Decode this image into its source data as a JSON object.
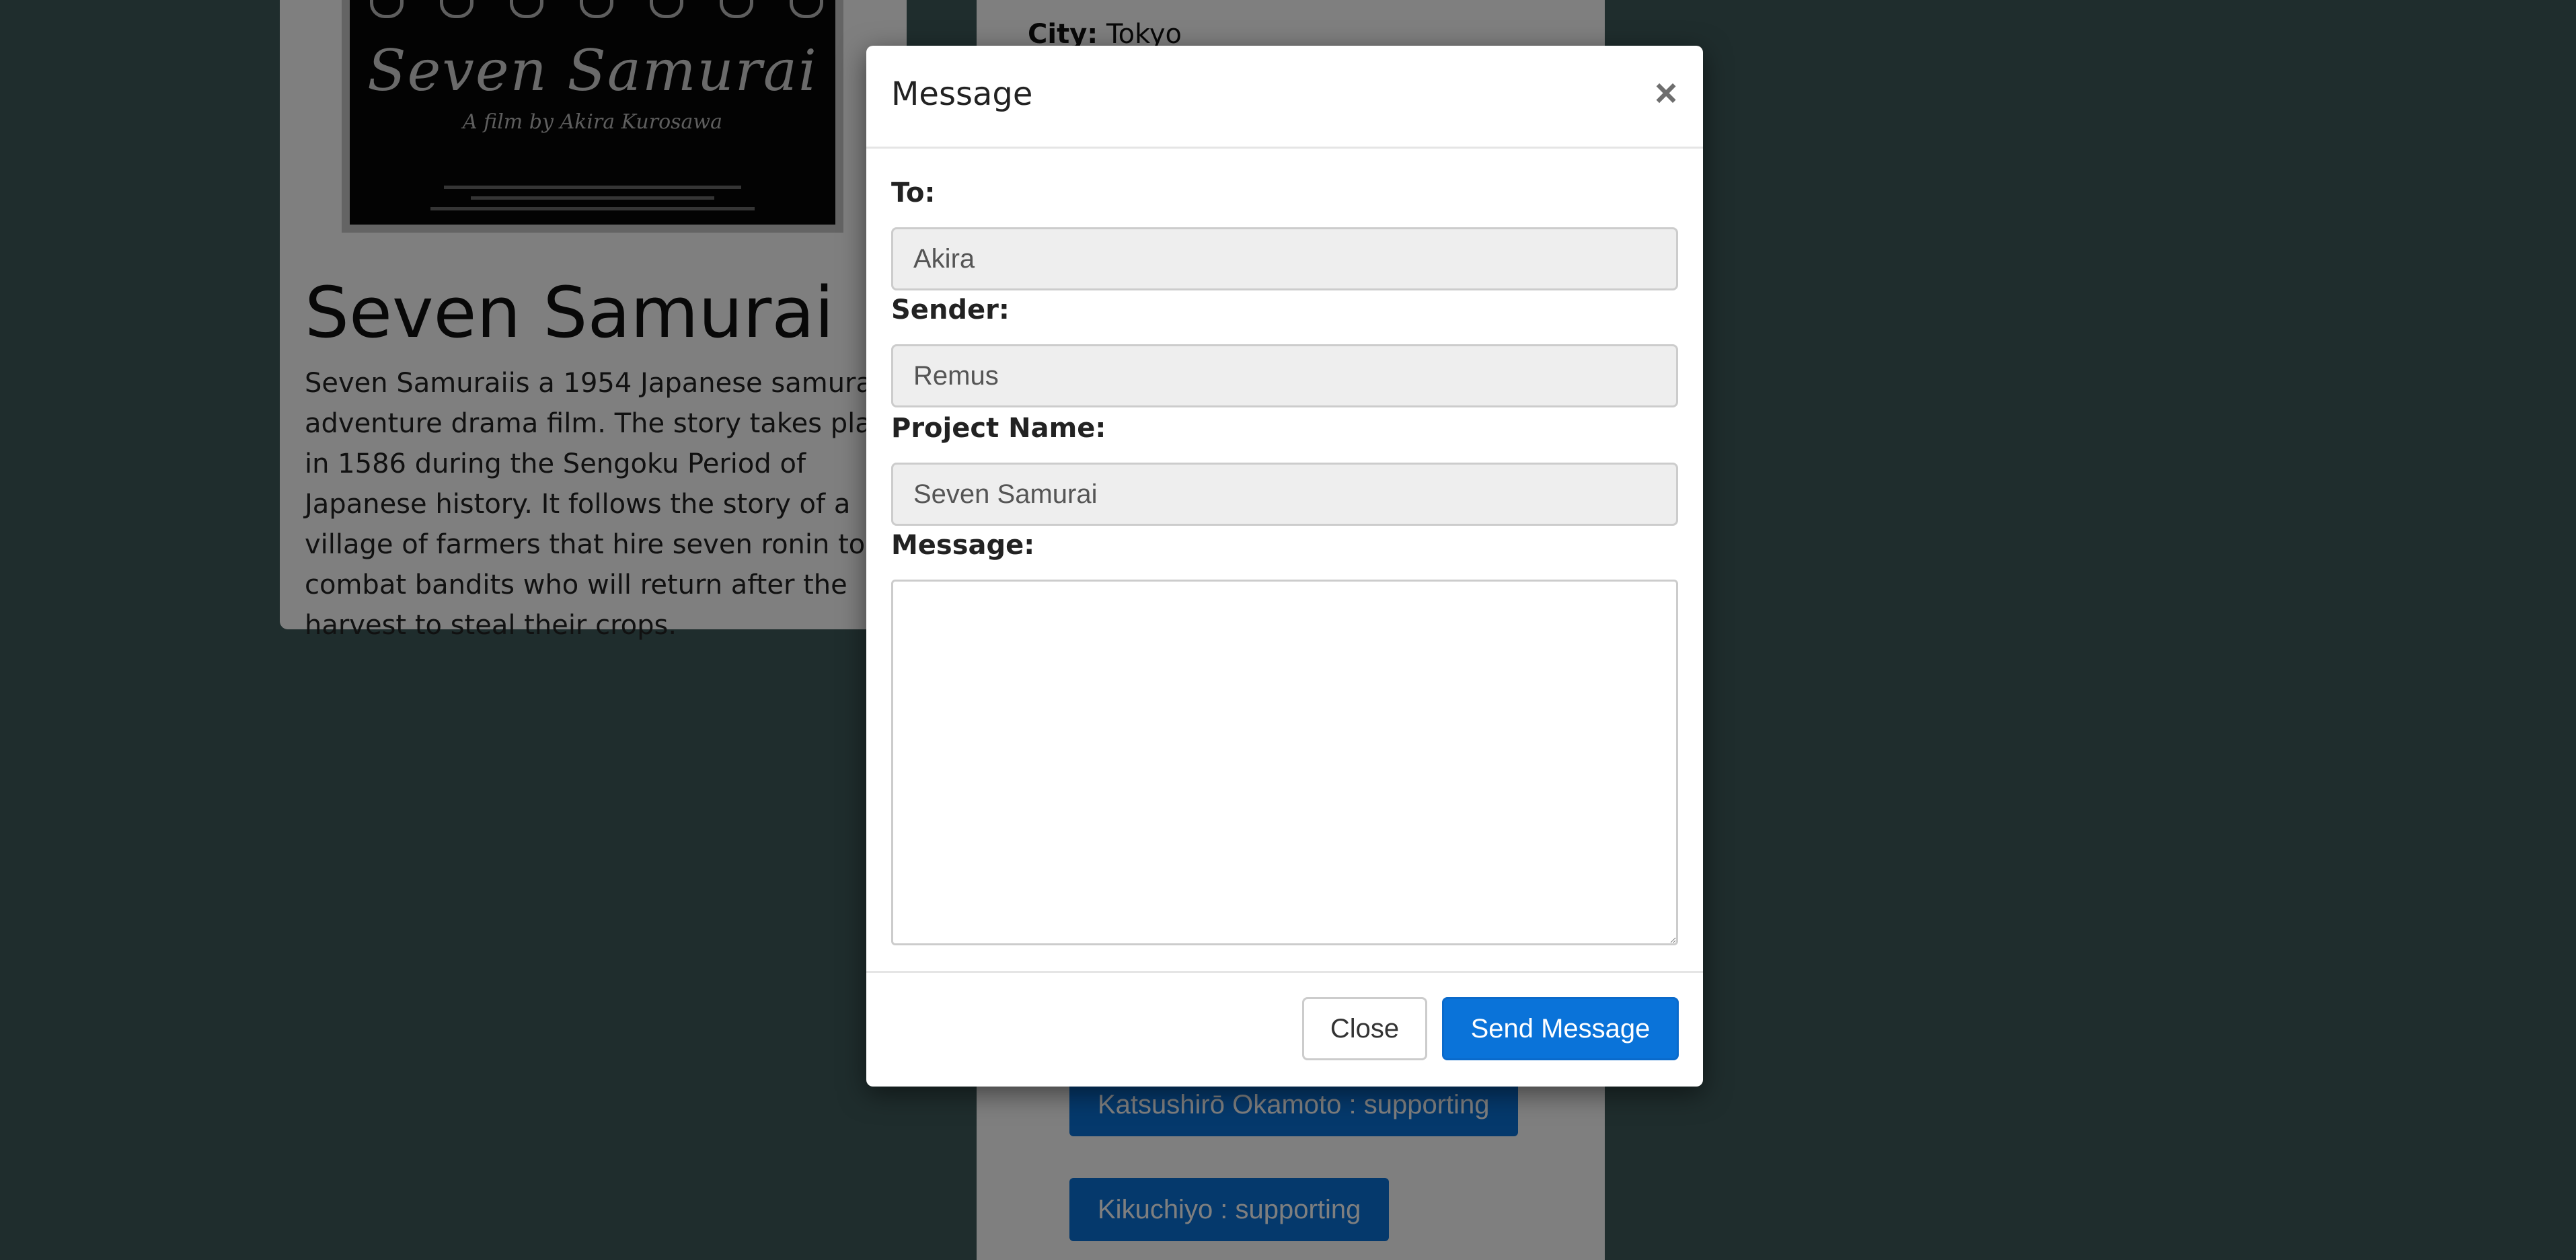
{
  "background": {
    "movie": {
      "title": "Seven Samurai",
      "description": "Seven Samuraiis a 1954 Japanese samurai adventure drama film. The story takes place in 1586 during the Sengoku Period of Japanese history. It follows the story of a village of farmers that hire seven ronin to combat bandits who will return after the harvest to steal their crops.",
      "poster": {
        "title": "Seven Samurai",
        "byline": "A film by Akira Kurosawa"
      }
    },
    "details": {
      "city_label": "City:",
      "city_value": "Tokyo"
    },
    "cast": [
      {
        "label": "Katsushirō Okamoto : supporting"
      },
      {
        "label": "Kikuchiyo : supporting"
      }
    ]
  },
  "modal": {
    "title": "Message",
    "close_symbol": "×",
    "fields": {
      "to_label": "To:",
      "to_value": "Akira",
      "sender_label": "Sender:",
      "sender_value": "Remus",
      "project_label": "Project Name:",
      "project_value": "Seven Samurai",
      "message_label": "Message:",
      "message_value": ""
    },
    "buttons": {
      "close": "Close",
      "send": "Send Message"
    }
  },
  "colors": {
    "page_background": "#3f5a5a",
    "primary": "#0a73d9",
    "input_background": "#eeeeee"
  }
}
